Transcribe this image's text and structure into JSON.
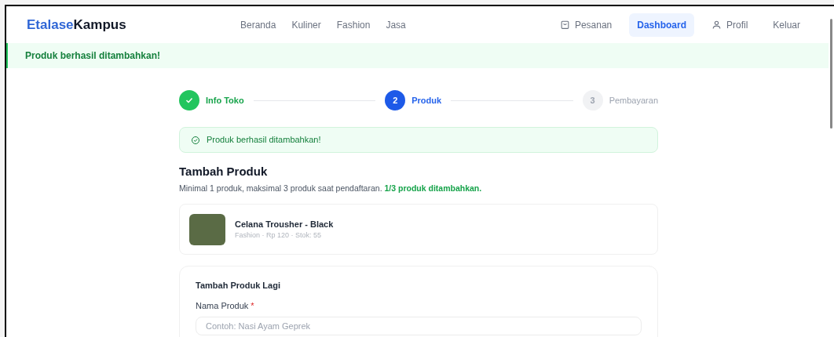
{
  "brand": {
    "first": "Etalase",
    "second": "Kampus"
  },
  "nav_links": [
    {
      "label": "Beranda",
      "selected": false
    },
    {
      "label": "Kuliner",
      "selected": false
    },
    {
      "label": "Fashion",
      "selected": false
    },
    {
      "label": "Jasa",
      "selected": false
    }
  ],
  "nav_actions": [
    {
      "label": "Pesanan",
      "kind": "bag",
      "selected": false
    },
    {
      "label": "Dashboard",
      "kind": "plain",
      "selected": true
    },
    {
      "label": "Profil",
      "kind": "user",
      "selected": false
    },
    {
      "label": "Keluar",
      "kind": "plain",
      "selected": false
    }
  ],
  "flash": "Produk berhasil ditambahkan!",
  "steps": [
    {
      "label": "Info Toko",
      "kind": "done"
    },
    {
      "marker": "2",
      "label": "Produk",
      "kind": "active"
    },
    {
      "marker": "3",
      "label": "Pembayaran",
      "kind": "pending"
    }
  ],
  "alert": "Produk berhasil ditambahkan!",
  "section": {
    "title": "Tambah Produk",
    "note": "Minimal 1 produk, maksimal 3 produk saat pendaftaran. **1/3 produk ditambahkan.**"
  },
  "products": [
    {
      "name": "Celana Trousher - Black",
      "meta": "Fashion · Rp 120 · Stok: 55"
    }
  ],
  "form": {
    "title": "Tambah Produk Lagi",
    "field_label": "Nama Produk",
    "required_mark": "*",
    "placeholder": "Contoh: Nasi Ayam Geprek"
  }
}
